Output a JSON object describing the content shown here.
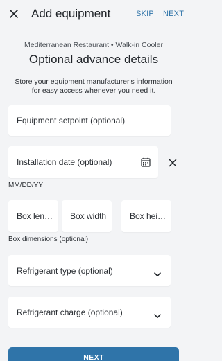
{
  "header": {
    "title": "Add equipment",
    "skip_label": "SKIP",
    "next_label": "NEXT"
  },
  "breadcrumb": "Mediterranean Restaurant • Walk-in Cooler",
  "section_title": "Optional advance details",
  "description": "Store your equipment manufacturer's information for easy access whenever you need it.",
  "fields": {
    "setpoint": {
      "label": "Equipment setpoint (optional)"
    },
    "installation_date": {
      "label": "Installation date (optional)",
      "hint": "MM/DD/YY"
    },
    "box": {
      "length_label": "Box length",
      "width_label": "Box width",
      "height_label": "Box height",
      "hint": "Box dimensions (optional)"
    },
    "refrigerant_type": {
      "label": "Refrigerant type (optional)"
    },
    "refrigerant_charge": {
      "label": "Refrigerant charge (optional)"
    }
  },
  "footer": {
    "next_button_label": "NEXT"
  },
  "colors": {
    "accent": "#2f74a9",
    "background": "#f3f4f6",
    "field": "#ffffff",
    "text": "#1f2328"
  },
  "icons": [
    "close-icon",
    "calendar-icon",
    "clear-icon",
    "chevron-down-icon"
  ]
}
